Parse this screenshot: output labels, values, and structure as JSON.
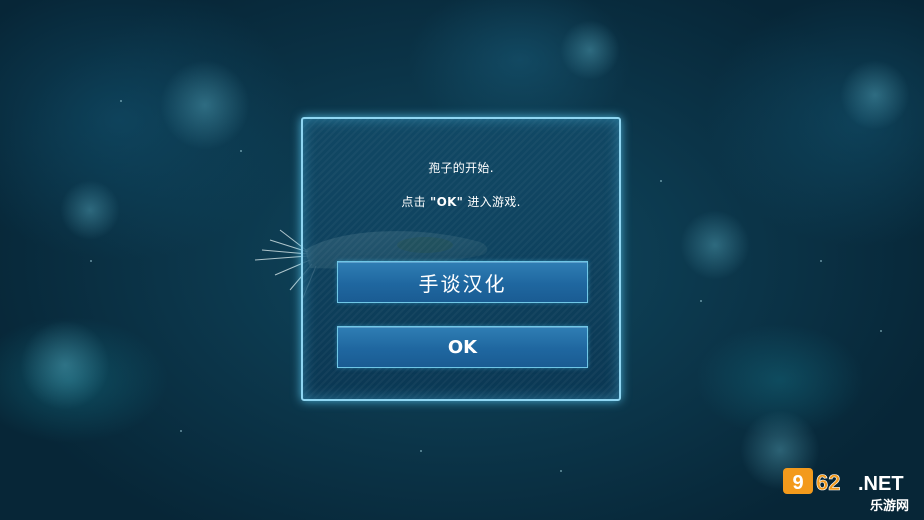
{
  "dialog": {
    "line1": "孢子的开始.",
    "line2_prefix": "点击 ",
    "line2_quoted": "\"OK\"",
    "line2_suffix": " 进入游戏."
  },
  "buttons": {
    "hanhua_label": "手谈汉化",
    "ok_label": "OK"
  },
  "watermark": {
    "number": "962",
    "suffix": ".NET",
    "subtitle": "乐游网"
  },
  "colors": {
    "dialog_border": "#8fd6f2",
    "button_fill": "#1f67a0",
    "button_border": "#6fc6e6",
    "background_deep": "#072637",
    "watermark_orange": "#f39a1c"
  },
  "icons": {
    "creature": "microbe-creature-icon",
    "watermark": "962-net-logo"
  }
}
